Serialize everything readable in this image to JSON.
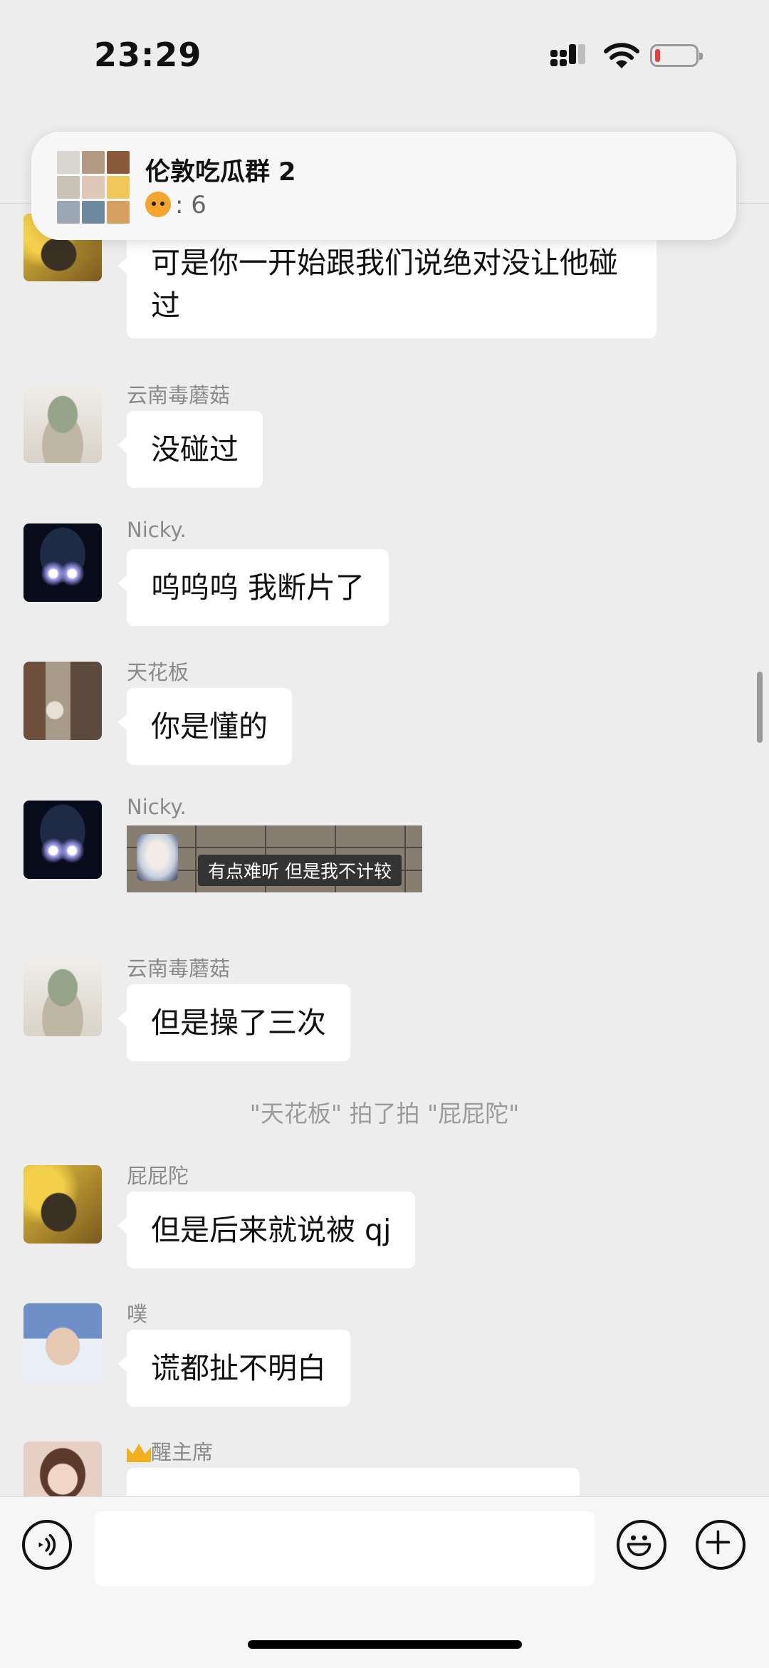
{
  "status_bar": {
    "time": "23:29"
  },
  "notification": {
    "title": "伦敦吃瓜群 2",
    "preview": ": 6"
  },
  "messages": [
    {
      "sender": "",
      "text": "可是你一开始跟我们说绝对没让他碰过"
    },
    {
      "sender": "云南毒蘑菇",
      "text": "没碰过"
    },
    {
      "sender": "Nicky.",
      "text": "呜呜呜  我断片了"
    },
    {
      "sender": "天花板",
      "text": "你是懂的"
    },
    {
      "sender": "Nicky.",
      "sticker_caption": "有点难听 但是我不计较"
    },
    {
      "sender": "云南毒蘑菇",
      "text": "但是操了三次"
    },
    {
      "sender": "屁屁陀",
      "text": "但是后来就说被 qj"
    },
    {
      "sender": "噗",
      "text": "谎都扯不明白"
    },
    {
      "sender": "醒主席",
      "text": ""
    }
  ],
  "system_message": "\"天花板\" 拍了拍 \"屁屁陀\"",
  "input": {
    "placeholder": ""
  },
  "icons": {
    "voice": "voice-icon",
    "emoji": "emoji-icon",
    "plus": "plus-icon",
    "signal": "signal-icon",
    "wifi": "wifi-icon",
    "battery": "battery-icon"
  },
  "colors": {
    "background": "#ededed",
    "bubble": "#ffffff",
    "battery_low": "#ef3b3b"
  }
}
